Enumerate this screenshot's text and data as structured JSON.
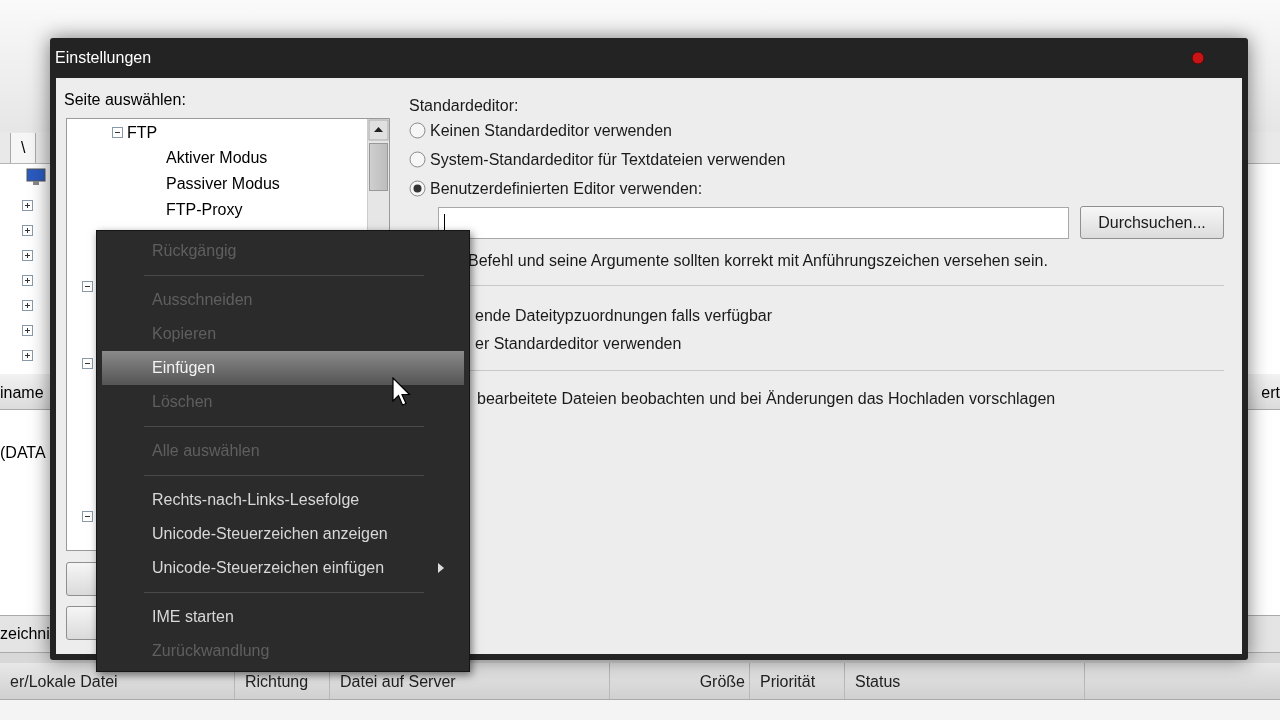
{
  "background_window": {
    "tab_label": "\\",
    "tree_nodes": [
      {
        "expanded": false
      },
      {
        "expanded": false
      },
      {
        "expanded": false
      },
      {
        "expanded": false
      },
      {
        "expanded": false
      },
      {
        "expanded": false
      },
      {
        "expanded": false
      }
    ],
    "list_header_left": "iname",
    "list_header_right": "ert",
    "list_row": "(DATA",
    "bottom_tab": "zeichni",
    "queue_columns": [
      "er/Lokale Datei",
      "Richtung",
      "Datei auf Server",
      "Größe",
      "Priorität",
      "Status"
    ]
  },
  "dialog": {
    "title": "Einstellungen",
    "page_label": "Seite auswählen:",
    "tree": [
      {
        "label": "FTP",
        "expanded": true,
        "children": [
          {
            "label": "Aktiver Modus"
          },
          {
            "label": "Passiver Modus"
          },
          {
            "label": "FTP-Proxy"
          }
        ]
      }
    ],
    "tree_below_menu": [
      {
        "expanded": true
      },
      {
        "expanded": true
      },
      {
        "expanded": true
      }
    ],
    "editor_heading": "Standardeditor:",
    "editor_options": [
      {
        "label": "Keinen Standardeditor verwenden",
        "selected": false
      },
      {
        "label": "System-Standardeditor für Textdateien verwenden",
        "selected": false
      },
      {
        "label": "Benutzerdefinierten Editor verwenden:",
        "selected": true
      }
    ],
    "browse_button": "Durchsuchen...",
    "hint": "Befehl und seine Argumente sollten korrekt mit Anführungszeichen versehen sein.",
    "association_lines": [
      "ende Dateitypzuordnungen falls verfügbar",
      "er Standardeditor verwenden"
    ],
    "watch_label": "bearbeitete Dateien beobachten und bei Änderungen das Hochladen vorschlagen"
  },
  "context_menu": {
    "items": [
      {
        "kind": "item",
        "label": "Rückgängig",
        "disabled": true,
        "selected": false,
        "submenu": false
      },
      {
        "kind": "separator"
      },
      {
        "kind": "item",
        "label": "Ausschneiden",
        "disabled": true,
        "selected": false,
        "submenu": false
      },
      {
        "kind": "item",
        "label": "Kopieren",
        "disabled": true,
        "selected": false,
        "submenu": false
      },
      {
        "kind": "item",
        "label": "Einfügen",
        "disabled": false,
        "selected": true,
        "submenu": false
      },
      {
        "kind": "item",
        "label": "Löschen",
        "disabled": true,
        "selected": false,
        "submenu": false
      },
      {
        "kind": "separator"
      },
      {
        "kind": "item",
        "label": "Alle auswählen",
        "disabled": true,
        "selected": false,
        "submenu": false
      },
      {
        "kind": "separator"
      },
      {
        "kind": "item",
        "label": "Rechts-nach-Links-Lesefolge",
        "disabled": false,
        "selected": false,
        "submenu": false
      },
      {
        "kind": "item",
        "label": "Unicode-Steuerzeichen anzeigen",
        "disabled": false,
        "selected": false,
        "submenu": false
      },
      {
        "kind": "item",
        "label": "Unicode-Steuerzeichen einfügen",
        "disabled": false,
        "selected": false,
        "submenu": true
      },
      {
        "kind": "separator"
      },
      {
        "kind": "item",
        "label": "IME starten",
        "disabled": false,
        "selected": false,
        "submenu": false
      },
      {
        "kind": "item",
        "label": "Zurückwandlung",
        "disabled": true,
        "selected": false,
        "submenu": false
      }
    ]
  }
}
